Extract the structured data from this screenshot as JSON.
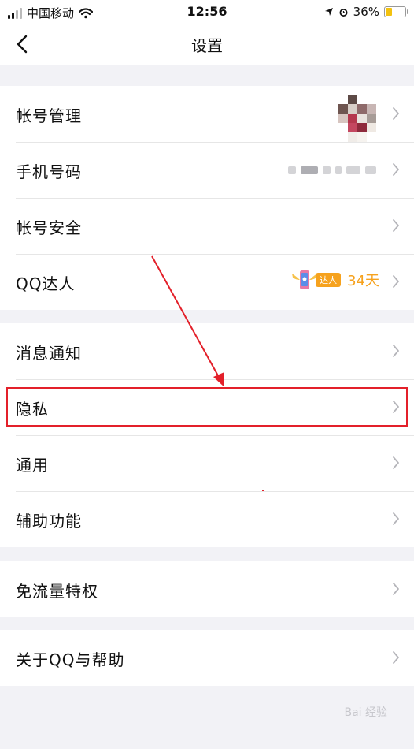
{
  "status_bar": {
    "carrier": "中国移动",
    "time": "12:56",
    "battery": "36%",
    "battery_level": 0.36
  },
  "nav": {
    "title": "设置",
    "back_icon": "chevron-left-icon"
  },
  "groups": [
    {
      "rows": [
        {
          "label": "帐号管理",
          "accessory": "avatar"
        },
        {
          "label": "手机号码",
          "accessory": "phone"
        },
        {
          "label": "帐号安全"
        },
        {
          "label": "QQ达人",
          "accessory": "talent",
          "badge": "达人",
          "days": "34天"
        }
      ]
    },
    {
      "rows": [
        {
          "label": "消息通知"
        },
        {
          "label": "隐私",
          "highlighted": true
        },
        {
          "label": "通用"
        },
        {
          "label": "辅助功能"
        }
      ]
    },
    {
      "rows": [
        {
          "label": "免流量特权"
        }
      ]
    },
    {
      "rows": [
        {
          "label": "关于QQ与帮助"
        }
      ]
    }
  ],
  "colors": {
    "accent": "#f6a21e",
    "annotation": "#e3202a",
    "background": "#f2f2f6"
  },
  "watermark": "Bai 经验"
}
